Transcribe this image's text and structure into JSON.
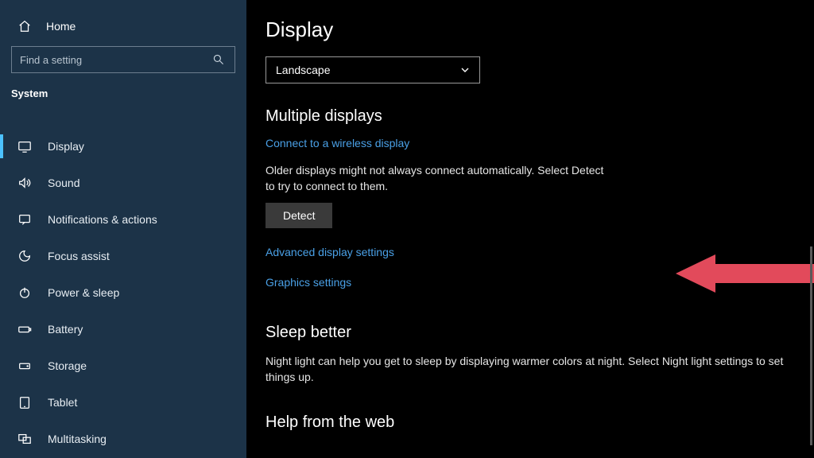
{
  "sidebar": {
    "home_label": "Home",
    "search_placeholder": "Find a setting",
    "section_label": "System",
    "items": [
      {
        "label": "Display",
        "icon": "display-icon",
        "active": true
      },
      {
        "label": "Sound",
        "icon": "sound-icon"
      },
      {
        "label": "Notifications & actions",
        "icon": "notifications-icon"
      },
      {
        "label": "Focus assist",
        "icon": "focus-assist-icon"
      },
      {
        "label": "Power & sleep",
        "icon": "power-icon"
      },
      {
        "label": "Battery",
        "icon": "battery-icon"
      },
      {
        "label": "Storage",
        "icon": "storage-icon"
      },
      {
        "label": "Tablet",
        "icon": "tablet-icon"
      },
      {
        "label": "Multitasking",
        "icon": "multitasking-icon"
      }
    ]
  },
  "main": {
    "title": "Display",
    "orientation_select": {
      "value": "Landscape"
    },
    "multiple_displays": {
      "heading": "Multiple displays",
      "wireless_link": "Connect to a wireless display",
      "detect_desc": "Older displays might not always connect automatically. Select Detect to try to connect to them.",
      "detect_button": "Detect",
      "advanced_link": "Advanced display settings",
      "graphics_link": "Graphics settings"
    },
    "sleep_better": {
      "heading": "Sleep better",
      "desc": "Night light can help you get to sleep by displaying warmer colors at night. Select Night light settings to set things up."
    },
    "help": {
      "heading": "Help from the web"
    }
  },
  "annotation": {
    "arrow_color": "#e24a5b"
  }
}
